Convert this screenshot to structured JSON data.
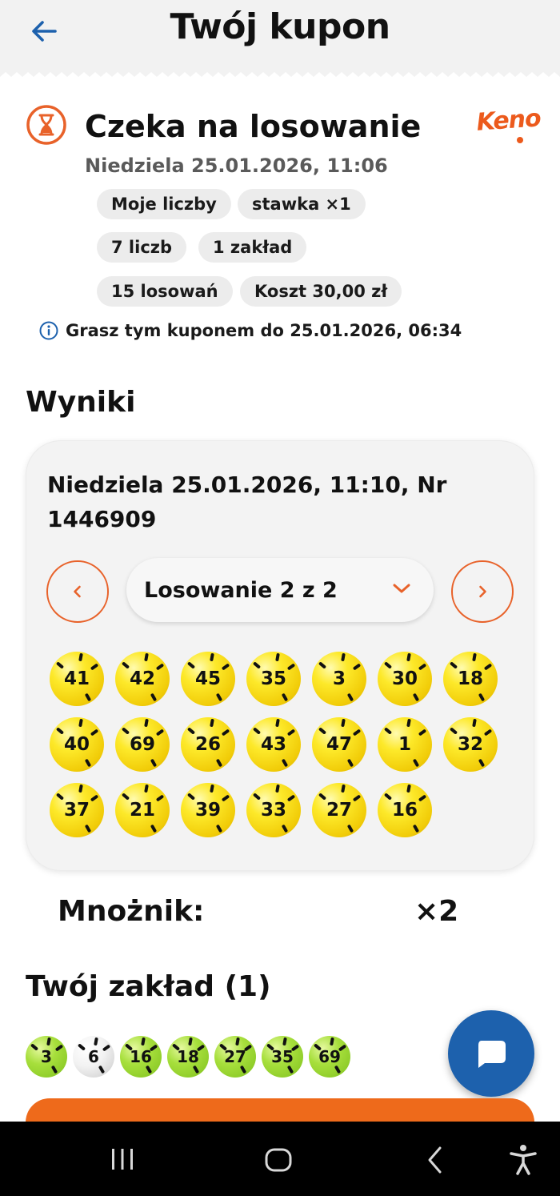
{
  "header": {
    "title": "Twój kupon",
    "back_icon": "arrow-left-icon"
  },
  "status": {
    "icon": "hourglass-icon",
    "title": "Czeka na losowanie",
    "date": "Niedziela 25.01.2026, 11:06",
    "game_logo": "Keno",
    "chips": [
      "Moje liczby",
      "stawka ×1",
      "7 liczb",
      "1 zakład",
      "15 losowań",
      "Koszt 30,00 zł"
    ],
    "info_text": "Grasz tym kuponem do 25.01.2026, 06:34"
  },
  "results": {
    "section_title": "Wyniki",
    "draw_title": "Niedziela 25.01.2026, 11:10, Nr 1446909",
    "draw_select_label": "Losowanie 2 z 2",
    "drawn_numbers": [
      "41",
      "42",
      "45",
      "35",
      "3",
      "30",
      "18",
      "40",
      "69",
      "26",
      "43",
      "47",
      "1",
      "32",
      "37",
      "21",
      "39",
      "33",
      "27",
      "16"
    ]
  },
  "multiplier": {
    "label": "Mnożnik:",
    "value": "×2"
  },
  "bet": {
    "section_title": "Twój zakład (1)",
    "numbers": [
      {
        "value": "3",
        "hit": true
      },
      {
        "value": "6",
        "hit": false
      },
      {
        "value": "16",
        "hit": true
      },
      {
        "value": "18",
        "hit": true
      },
      {
        "value": "27",
        "hit": true
      },
      {
        "value": "35",
        "hit": true
      },
      {
        "value": "69",
        "hit": true
      }
    ]
  },
  "colors": {
    "accent_orange": "#e8622a",
    "ball_yellow": "#fde92a",
    "hit_green": "#a7df3c",
    "fab_blue": "#1d61ad",
    "info_blue": "#1d61ad"
  }
}
